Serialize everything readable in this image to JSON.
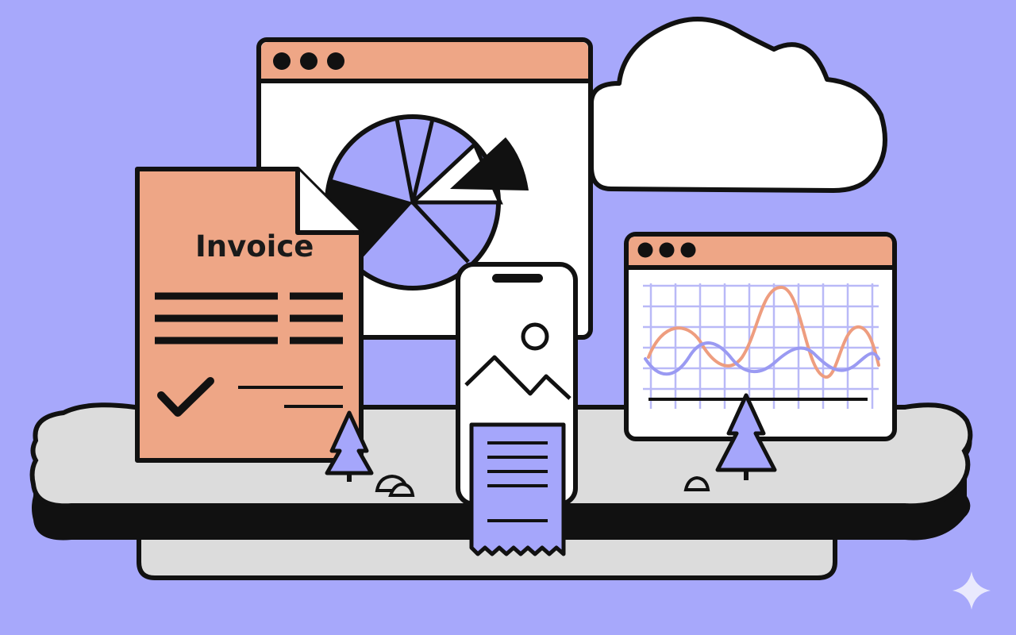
{
  "invoice": {
    "title": "Invoice"
  },
  "colors": {
    "background": "#a7a8fb",
    "salmon": "#eea686",
    "lavender": "#a5a6fb",
    "outline": "#111111",
    "white": "#ffffff",
    "platform": "#dcdcdc",
    "wave_orange": "#ee9d7f",
    "wave_purple": "#9a9af2",
    "grid": "#b9b9f7"
  },
  "icons": [
    "browser-window-icon",
    "pie-chart-icon",
    "cloud-icon",
    "invoice-document-icon",
    "checkmark-icon",
    "smartphone-icon",
    "mountain-image-icon",
    "sun-icon",
    "receipt-icon",
    "line-chart-window-icon",
    "pine-tree-icon",
    "rock-icon",
    "sparkle-icon"
  ]
}
